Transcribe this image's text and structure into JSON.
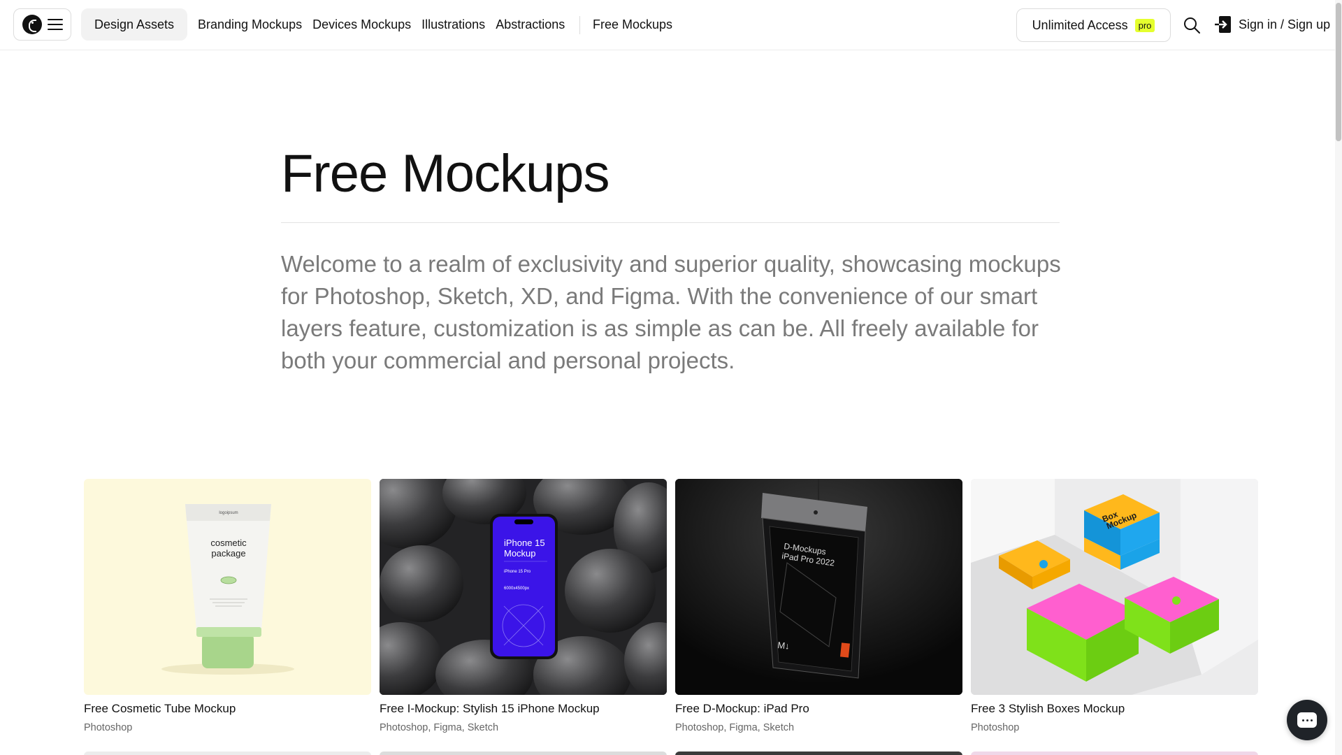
{
  "header": {
    "logo_icon": "ls-logo-icon",
    "menu_icon": "hamburger-icon",
    "active_tab": "Design Assets",
    "nav_items": [
      "Branding Mockups",
      "Devices Mockups",
      "Illustrations",
      "Abstractions"
    ],
    "free_link": "Free Mockups",
    "unlimited_label": "Unlimited Access",
    "pro_badge": "pro",
    "search_icon": "search-icon",
    "signin_icon": "sign-in-icon",
    "signin_label": "Sign in / Sign up"
  },
  "hero": {
    "title": "Free Mockups",
    "description": "Welcome to a realm of exclusivity and superior quality, showcasing mockups for Photoshop, Sketch, XD, and Figma. With the convenience of our smart layers feature, customization is as simple as can be. All freely available for both your commercial and personal projects."
  },
  "cards": [
    {
      "title": "Free Cosmetic Tube Mockup",
      "tags": "Photoshop",
      "thumb_bg": "#fdf9dc",
      "thumb_text": [
        "cosmetic",
        "package"
      ],
      "thumb_brand": "logoipsum"
    },
    {
      "title": "Free I-Mockup: Stylish 15 iPhone Mockup",
      "tags": "Photoshop, Figma, Sketch",
      "thumb_bg": "#3a3a3c",
      "thumb_text": [
        "iPhone 15",
        "Mockup",
        "iPhone 15 Pro",
        "6000x4500px"
      ]
    },
    {
      "title": "Free D-Mockup: iPad Pro",
      "tags": "Photoshop, Figma, Sketch",
      "thumb_bg": "#0e0e0e",
      "thumb_text": [
        "D-Mockups",
        "iPad Pro 2022",
        "M↓"
      ]
    },
    {
      "title": "Free 3 Stylish Boxes Mockup",
      "tags": "Photoshop",
      "thumb_bg": "#e9e9ea",
      "thumb_text": [
        "Box",
        "Mockup"
      ]
    }
  ],
  "chat": {
    "icon": "chat-icon"
  },
  "colors": {
    "accent_pro": "#e5ff2e",
    "text_muted": "#7a7a7a",
    "iphone_screen": "#3b14e8"
  }
}
